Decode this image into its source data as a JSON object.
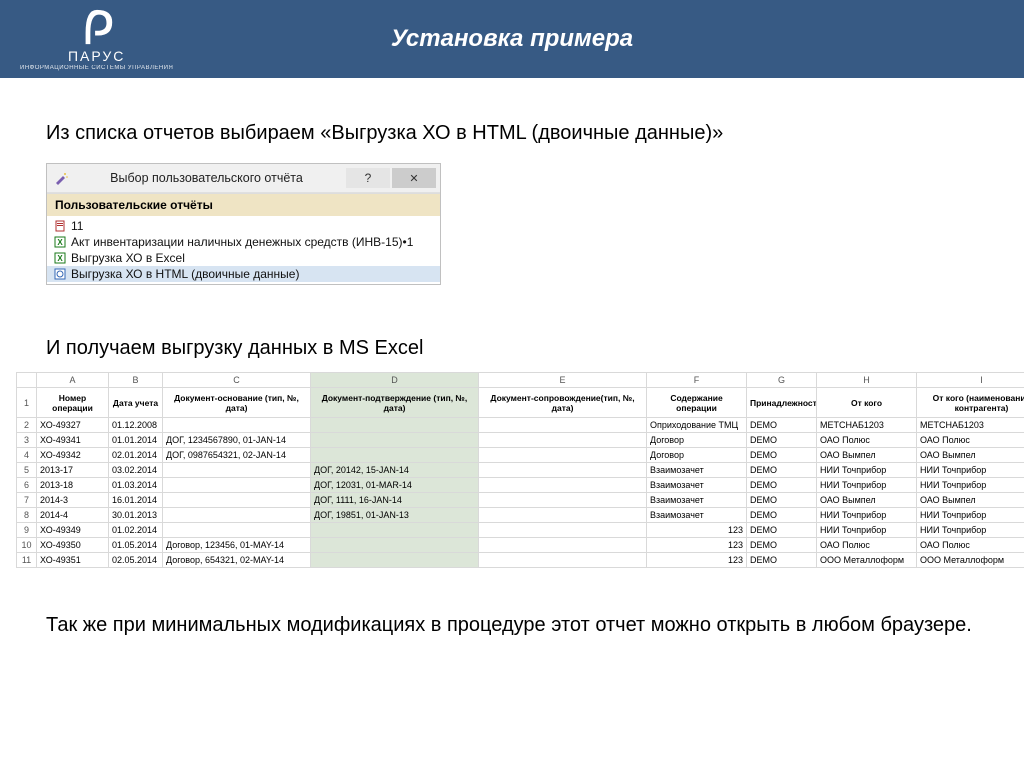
{
  "header": {
    "title": "Установка примера",
    "logo_name": "ПАРУС",
    "logo_sub": "ИНФОРМАЦИОННЫЕ СИСТЕМЫ УПРАВЛЕНИЯ"
  },
  "texts": {
    "p1": "Из списка отчетов выбираем «Выгрузка ХО в HTML (двоичные данные)»",
    "p2": "И получаем выгрузку данных в MS Excel",
    "p3": "Так же при минимальных модификациях в процедуре этот отчет можно открыть в любом браузере."
  },
  "dialog": {
    "title": "Выбор пользовательского отчёта",
    "help": "?",
    "close": "✕",
    "section": "Пользовательские отчёты",
    "items": [
      {
        "icon": "doc",
        "label": "11"
      },
      {
        "icon": "xl",
        "label": "Акт инвентаризации наличных денежных средств (ИНВ-15)•1"
      },
      {
        "icon": "xl",
        "label": "Выгрузка ХО в Excel"
      },
      {
        "icon": "html",
        "label": "Выгрузка ХО в HTML (двоичные данные)",
        "selected": true
      }
    ]
  },
  "excel": {
    "col_letters": [
      "A",
      "B",
      "C",
      "D",
      "E",
      "F",
      "G",
      "H",
      "I"
    ],
    "headers": [
      "Номер операции",
      "Дата учета",
      "Документ-основание (тип, №, дата)",
      "Документ-подтверждение (тип, №, дата)",
      "Документ-сопровождение(тип, №, дата)",
      "Содержание операции",
      "Принадлежность",
      "От кого",
      "От кого (наименование контрагента)"
    ],
    "rows": [
      {
        "n": 2,
        "cells": [
          "ХО-49327",
          "01.12.2008",
          "",
          "",
          "",
          "Оприходование ТМЦ",
          "DEMO",
          "МЕТСНАБ1203",
          "МЕТСНАБ1203"
        ]
      },
      {
        "n": 3,
        "cells": [
          "ХО-49341",
          "01.01.2014",
          "ДОГ, 1234567890, 01-JAN-14",
          "",
          "",
          "Договор",
          "DEMO",
          "ОАО Полюс",
          "ОАО Полюс"
        ]
      },
      {
        "n": 4,
        "cells": [
          "ХО-49342",
          "02.01.2014",
          "ДОГ, 0987654321, 02-JAN-14",
          "",
          "",
          "Договор",
          "DEMO",
          "ОАО Вымпел",
          "ОАО Вымпел"
        ]
      },
      {
        "n": 5,
        "cells": [
          "2013-17",
          "03.02.2014",
          "",
          "ДОГ, 20142, 15-JAN-14",
          "",
          "Взаимозачет",
          "DEMO",
          "НИИ Точприбор",
          "НИИ Точприбор"
        ]
      },
      {
        "n": 6,
        "cells": [
          "2013-18",
          "01.03.2014",
          "",
          "ДОГ, 12031, 01-MAR-14",
          "",
          "Взаимозачет",
          "DEMO",
          "НИИ Точприбор",
          "НИИ Точприбор"
        ]
      },
      {
        "n": 7,
        "cells": [
          "2014-3",
          "16.01.2014",
          "",
          "ДОГ, 1111, 16-JAN-14",
          "",
          "Взаимозачет",
          "DEMO",
          "ОАО Вымпел",
          "ОАО Вымпел"
        ]
      },
      {
        "n": 8,
        "cells": [
          "2014-4",
          "30.01.2013",
          "",
          "ДОГ, 19851, 01-JAN-13",
          "",
          "Взаимозачет",
          "DEMO",
          "НИИ Точприбор",
          "НИИ Точприбор"
        ]
      },
      {
        "n": 9,
        "cells": [
          "ХО-49349",
          "01.02.2014",
          "",
          "",
          "",
          "123",
          "DEMO",
          "НИИ Точприбор",
          "НИИ Точприбор"
        ]
      },
      {
        "n": 10,
        "cells": [
          "ХО-49350",
          "01.05.2014",
          "Договор, 123456, 01-MAY-14",
          "",
          "",
          "123",
          "DEMO",
          "ОАО Полюс",
          "ОАО Полюс"
        ]
      },
      {
        "n": 11,
        "cells": [
          "ХО-49351",
          "02.05.2014",
          "Договор, 654321, 02-MAY-14",
          "",
          "",
          "123",
          "DEMO",
          "ООО Металлоформ",
          "ООО Металлоформ"
        ]
      }
    ]
  }
}
